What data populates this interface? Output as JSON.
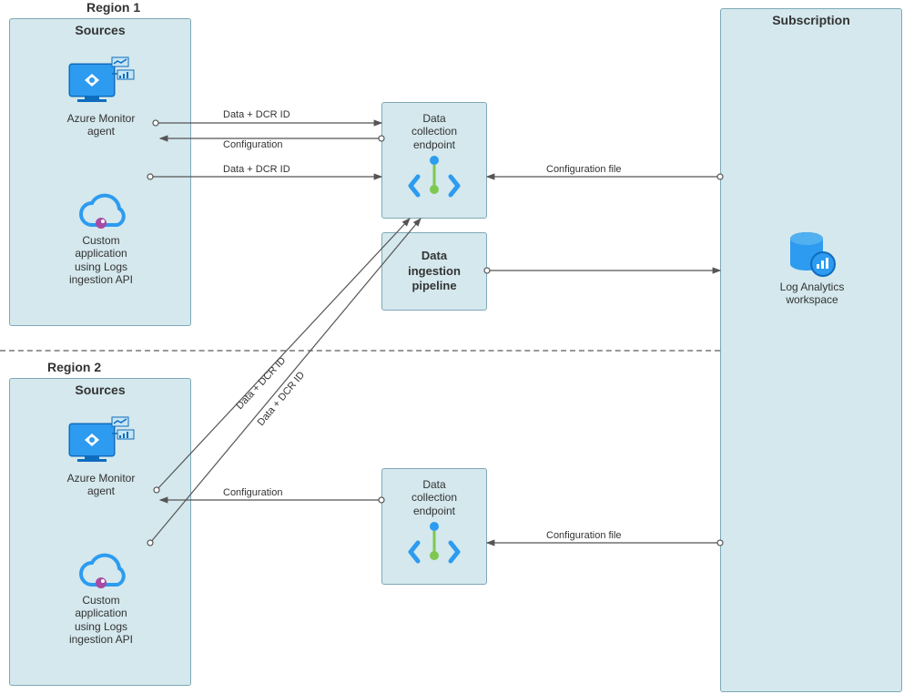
{
  "regions": {
    "r1": "Region 1",
    "r2": "Region 2"
  },
  "sources_title": "Sources",
  "subscription_title": "Subscription",
  "nodes": {
    "ama": "Azure Monitor\nagent",
    "custom": "Custom\napplication\nusing Logs\ningestion API",
    "dce": "Data\ncollection\nendpoint",
    "dip": "Data\ningestion\npipeline",
    "law": "Log Analytics\nworkspace"
  },
  "edges": {
    "data_dcr": "Data + DCR ID",
    "config": "Configuration",
    "config_file": "Configuration file"
  }
}
